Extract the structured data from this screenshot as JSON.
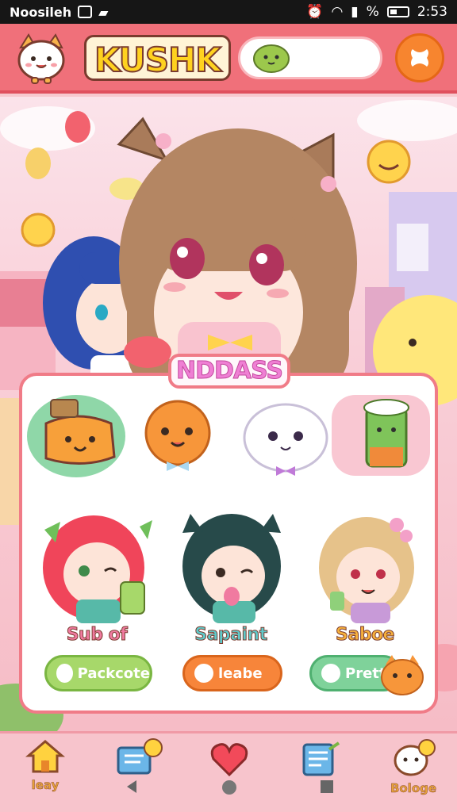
{
  "status_bar": {
    "carrier": "Noosileh",
    "signal_text": "%",
    "time": "2:53"
  },
  "header": {
    "app_title": "KUSHK"
  },
  "panel": {
    "title": "NDDASS",
    "characters": [
      {
        "name": "Sub of",
        "button_label": "Packcote",
        "name_color": "#f07aa0"
      },
      {
        "name": "Sapaint",
        "button_label": "leabe",
        "name_color": "#5fc9c9"
      },
      {
        "name": "Saboe",
        "button_label": "Prett",
        "name_color": "#f7b13c"
      }
    ]
  },
  "bottom_nav": {
    "items": [
      {
        "label": "leay"
      },
      {
        "label": ""
      },
      {
        "label": ""
      },
      {
        "label": ""
      },
      {
        "label": "Bologe"
      }
    ]
  },
  "colors": {
    "header_bg": "#f0707a",
    "accent_orange": "#f7852f",
    "panel_border": "#f07b87"
  }
}
